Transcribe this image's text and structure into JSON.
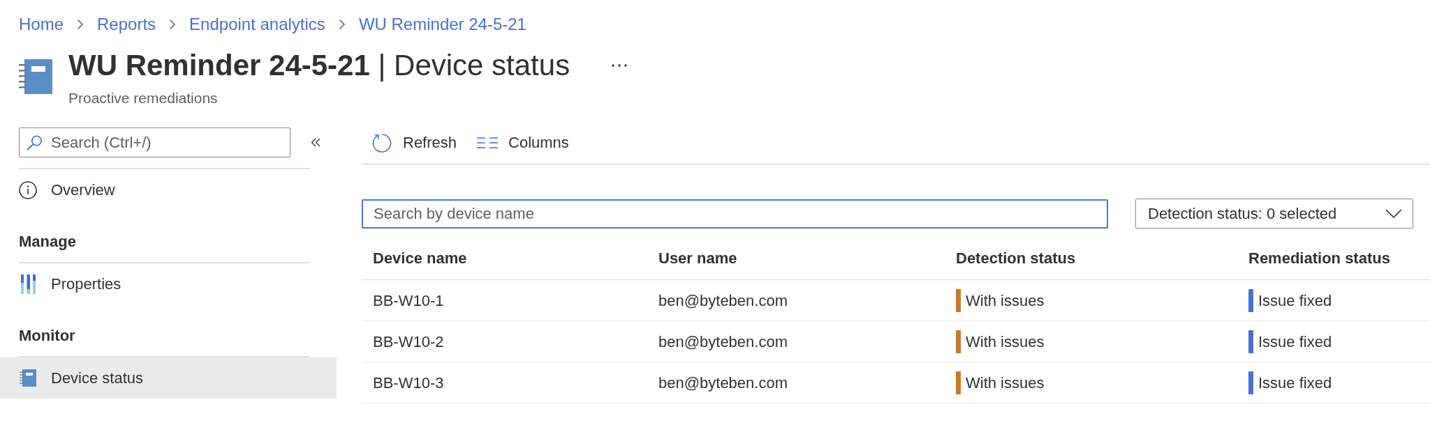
{
  "breadcrumb": [
    {
      "label": "Home"
    },
    {
      "label": "Reports"
    },
    {
      "label": "Endpoint analytics"
    },
    {
      "label": "WU Reminder 24-5-21"
    }
  ],
  "header": {
    "title": "**WU Reminder 24-5-21** | Device status",
    "subtitle": "Proactive remediations"
  },
  "sidebar": {
    "search": {
      "placeholder": "Search (Ctrl+/)"
    },
    "sections": [
      {
        "items": [
          {
            "label": "Overview",
            "selected": false
          }
        ]
      },
      {
        "heading": "Manage",
        "items": [
          {
            "label": "Properties",
            "selected": false
          }
        ]
      },
      {
        "heading": "Monitor",
        "items": [
          {
            "label": "Device status",
            "selected": true
          }
        ]
      }
    ]
  },
  "toolbar": [
    {
      "label": "Refresh"
    },
    {
      "label": "Columns"
    }
  ],
  "filters": {
    "search": {
      "placeholder": "Search by device name",
      "focused": true
    },
    "dropdown": {
      "label": "Detection status: 0 selected"
    }
  },
  "table": {
    "columns": [
      "Device name",
      "User name",
      "Detection status",
      "Remediation status"
    ],
    "rows": [
      {
        "device_name": "BB-W10-1",
        "user_name": "ben@byteben.com",
        "detection_status": {
          "label": "With issues",
          "color": "#c87a2c"
        },
        "remediation_status": {
          "label": "Issue fixed",
          "color": "#4672d2"
        }
      },
      {
        "device_name": "BB-W10-2",
        "user_name": "ben@byteben.com",
        "detection_status": {
          "label": "With issues",
          "color": "#c87a2c"
        },
        "remediation_status": {
          "label": "Issue fixed",
          "color": "#4672d2"
        }
      },
      {
        "device_name": "BB-W10-3",
        "user_name": "ben@byteben.com",
        "detection_status": {
          "label": "With issues",
          "color": "#c87a2c"
        },
        "remediation_status": {
          "label": "Issue fixed",
          "color": "#4672d2"
        }
      }
    ]
  }
}
